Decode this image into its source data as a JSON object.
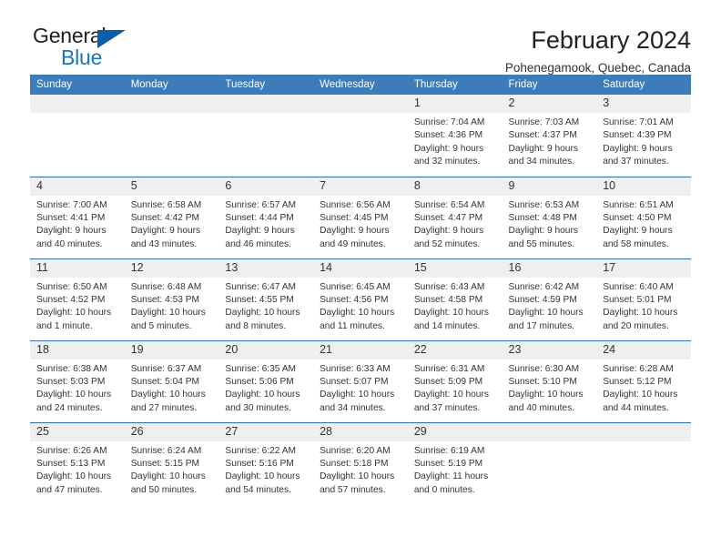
{
  "brand": {
    "name_top": "General",
    "name_bottom": "Blue",
    "accent_color": "#1b75bb",
    "triangle_color": "#0b5ea8"
  },
  "header": {
    "title": "February 2024",
    "subtitle": "Pohenegamook, Quebec, Canada"
  },
  "theme": {
    "header_blue": "#3b7cb9",
    "row_border_blue": "#2f6ca8",
    "daynum_band": "#efefef"
  },
  "weekdays": [
    "Sunday",
    "Monday",
    "Tuesday",
    "Wednesday",
    "Thursday",
    "Friday",
    "Saturday"
  ],
  "weeks": [
    [
      {
        "day": "",
        "sunrise": "",
        "sunset": "",
        "daylight1": "",
        "daylight2": ""
      },
      {
        "day": "",
        "sunrise": "",
        "sunset": "",
        "daylight1": "",
        "daylight2": ""
      },
      {
        "day": "",
        "sunrise": "",
        "sunset": "",
        "daylight1": "",
        "daylight2": ""
      },
      {
        "day": "",
        "sunrise": "",
        "sunset": "",
        "daylight1": "",
        "daylight2": ""
      },
      {
        "day": "1",
        "sunrise": "Sunrise: 7:04 AM",
        "sunset": "Sunset: 4:36 PM",
        "daylight1": "Daylight: 9 hours",
        "daylight2": "and 32 minutes."
      },
      {
        "day": "2",
        "sunrise": "Sunrise: 7:03 AM",
        "sunset": "Sunset: 4:37 PM",
        "daylight1": "Daylight: 9 hours",
        "daylight2": "and 34 minutes."
      },
      {
        "day": "3",
        "sunrise": "Sunrise: 7:01 AM",
        "sunset": "Sunset: 4:39 PM",
        "daylight1": "Daylight: 9 hours",
        "daylight2": "and 37 minutes."
      }
    ],
    [
      {
        "day": "4",
        "sunrise": "Sunrise: 7:00 AM",
        "sunset": "Sunset: 4:41 PM",
        "daylight1": "Daylight: 9 hours",
        "daylight2": "and 40 minutes."
      },
      {
        "day": "5",
        "sunrise": "Sunrise: 6:58 AM",
        "sunset": "Sunset: 4:42 PM",
        "daylight1": "Daylight: 9 hours",
        "daylight2": "and 43 minutes."
      },
      {
        "day": "6",
        "sunrise": "Sunrise: 6:57 AM",
        "sunset": "Sunset: 4:44 PM",
        "daylight1": "Daylight: 9 hours",
        "daylight2": "and 46 minutes."
      },
      {
        "day": "7",
        "sunrise": "Sunrise: 6:56 AM",
        "sunset": "Sunset: 4:45 PM",
        "daylight1": "Daylight: 9 hours",
        "daylight2": "and 49 minutes."
      },
      {
        "day": "8",
        "sunrise": "Sunrise: 6:54 AM",
        "sunset": "Sunset: 4:47 PM",
        "daylight1": "Daylight: 9 hours",
        "daylight2": "and 52 minutes."
      },
      {
        "day": "9",
        "sunrise": "Sunrise: 6:53 AM",
        "sunset": "Sunset: 4:48 PM",
        "daylight1": "Daylight: 9 hours",
        "daylight2": "and 55 minutes."
      },
      {
        "day": "10",
        "sunrise": "Sunrise: 6:51 AM",
        "sunset": "Sunset: 4:50 PM",
        "daylight1": "Daylight: 9 hours",
        "daylight2": "and 58 minutes."
      }
    ],
    [
      {
        "day": "11",
        "sunrise": "Sunrise: 6:50 AM",
        "sunset": "Sunset: 4:52 PM",
        "daylight1": "Daylight: 10 hours",
        "daylight2": "and 1 minute."
      },
      {
        "day": "12",
        "sunrise": "Sunrise: 6:48 AM",
        "sunset": "Sunset: 4:53 PM",
        "daylight1": "Daylight: 10 hours",
        "daylight2": "and 5 minutes."
      },
      {
        "day": "13",
        "sunrise": "Sunrise: 6:47 AM",
        "sunset": "Sunset: 4:55 PM",
        "daylight1": "Daylight: 10 hours",
        "daylight2": "and 8 minutes."
      },
      {
        "day": "14",
        "sunrise": "Sunrise: 6:45 AM",
        "sunset": "Sunset: 4:56 PM",
        "daylight1": "Daylight: 10 hours",
        "daylight2": "and 11 minutes."
      },
      {
        "day": "15",
        "sunrise": "Sunrise: 6:43 AM",
        "sunset": "Sunset: 4:58 PM",
        "daylight1": "Daylight: 10 hours",
        "daylight2": "and 14 minutes."
      },
      {
        "day": "16",
        "sunrise": "Sunrise: 6:42 AM",
        "sunset": "Sunset: 4:59 PM",
        "daylight1": "Daylight: 10 hours",
        "daylight2": "and 17 minutes."
      },
      {
        "day": "17",
        "sunrise": "Sunrise: 6:40 AM",
        "sunset": "Sunset: 5:01 PM",
        "daylight1": "Daylight: 10 hours",
        "daylight2": "and 20 minutes."
      }
    ],
    [
      {
        "day": "18",
        "sunrise": "Sunrise: 6:38 AM",
        "sunset": "Sunset: 5:03 PM",
        "daylight1": "Daylight: 10 hours",
        "daylight2": "and 24 minutes."
      },
      {
        "day": "19",
        "sunrise": "Sunrise: 6:37 AM",
        "sunset": "Sunset: 5:04 PM",
        "daylight1": "Daylight: 10 hours",
        "daylight2": "and 27 minutes."
      },
      {
        "day": "20",
        "sunrise": "Sunrise: 6:35 AM",
        "sunset": "Sunset: 5:06 PM",
        "daylight1": "Daylight: 10 hours",
        "daylight2": "and 30 minutes."
      },
      {
        "day": "21",
        "sunrise": "Sunrise: 6:33 AM",
        "sunset": "Sunset: 5:07 PM",
        "daylight1": "Daylight: 10 hours",
        "daylight2": "and 34 minutes."
      },
      {
        "day": "22",
        "sunrise": "Sunrise: 6:31 AM",
        "sunset": "Sunset: 5:09 PM",
        "daylight1": "Daylight: 10 hours",
        "daylight2": "and 37 minutes."
      },
      {
        "day": "23",
        "sunrise": "Sunrise: 6:30 AM",
        "sunset": "Sunset: 5:10 PM",
        "daylight1": "Daylight: 10 hours",
        "daylight2": "and 40 minutes."
      },
      {
        "day": "24",
        "sunrise": "Sunrise: 6:28 AM",
        "sunset": "Sunset: 5:12 PM",
        "daylight1": "Daylight: 10 hours",
        "daylight2": "and 44 minutes."
      }
    ],
    [
      {
        "day": "25",
        "sunrise": "Sunrise: 6:26 AM",
        "sunset": "Sunset: 5:13 PM",
        "daylight1": "Daylight: 10 hours",
        "daylight2": "and 47 minutes."
      },
      {
        "day": "26",
        "sunrise": "Sunrise: 6:24 AM",
        "sunset": "Sunset: 5:15 PM",
        "daylight1": "Daylight: 10 hours",
        "daylight2": "and 50 minutes."
      },
      {
        "day": "27",
        "sunrise": "Sunrise: 6:22 AM",
        "sunset": "Sunset: 5:16 PM",
        "daylight1": "Daylight: 10 hours",
        "daylight2": "and 54 minutes."
      },
      {
        "day": "28",
        "sunrise": "Sunrise: 6:20 AM",
        "sunset": "Sunset: 5:18 PM",
        "daylight1": "Daylight: 10 hours",
        "daylight2": "and 57 minutes."
      },
      {
        "day": "29",
        "sunrise": "Sunrise: 6:19 AM",
        "sunset": "Sunset: 5:19 PM",
        "daylight1": "Daylight: 11 hours",
        "daylight2": "and 0 minutes."
      },
      {
        "day": "",
        "sunrise": "",
        "sunset": "",
        "daylight1": "",
        "daylight2": ""
      },
      {
        "day": "",
        "sunrise": "",
        "sunset": "",
        "daylight1": "",
        "daylight2": ""
      }
    ]
  ]
}
